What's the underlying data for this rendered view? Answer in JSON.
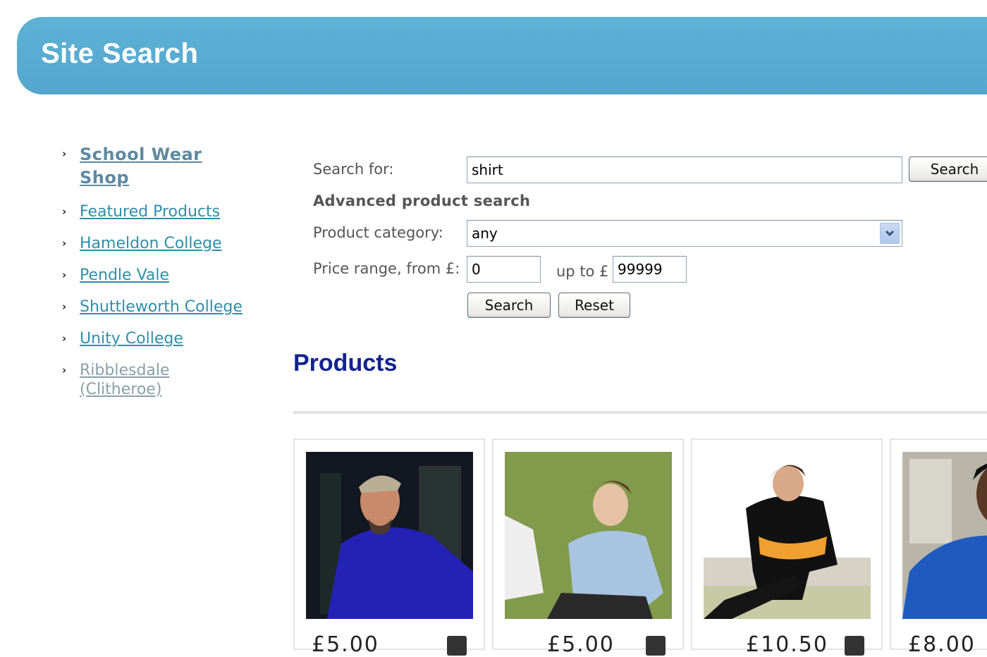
{
  "header": {
    "title": "Site Search"
  },
  "sidebar": {
    "items": [
      {
        "label": "School Wear Shop",
        "line1": "School Wear",
        "line2": "Shop"
      },
      {
        "label": "Featured Products"
      },
      {
        "label": "Hameldon College"
      },
      {
        "label": "Pendle Vale"
      },
      {
        "label": "Shuttleworth College"
      },
      {
        "label": "Unity College"
      },
      {
        "label": "Ribblesdale (Clitheroe)",
        "line1": "Ribblesdale",
        "line2": "(Clitheroe)"
      }
    ]
  },
  "search": {
    "label": "Search for:",
    "value": "shirt",
    "button": "Search"
  },
  "advanced": {
    "title": "Advanced product search",
    "category_label": "Product category:",
    "category_value": "any",
    "price_label": "Price range, from £:",
    "price_from": "0",
    "price_to_label": "up to £",
    "price_to": "99999",
    "search_button": "Search",
    "reset_button": "Reset"
  },
  "products": {
    "title": "Products",
    "items": [
      {
        "price": "£5.00",
        "image": "navy polo shirt man in cap"
      },
      {
        "price": "£5.00",
        "image": "light blue polo shirt boy on grass"
      },
      {
        "price": "£10.50",
        "image": "black and amber rugby shirt"
      },
      {
        "price": "£8.00",
        "image": "royal blue t-shirt"
      }
    ]
  }
}
